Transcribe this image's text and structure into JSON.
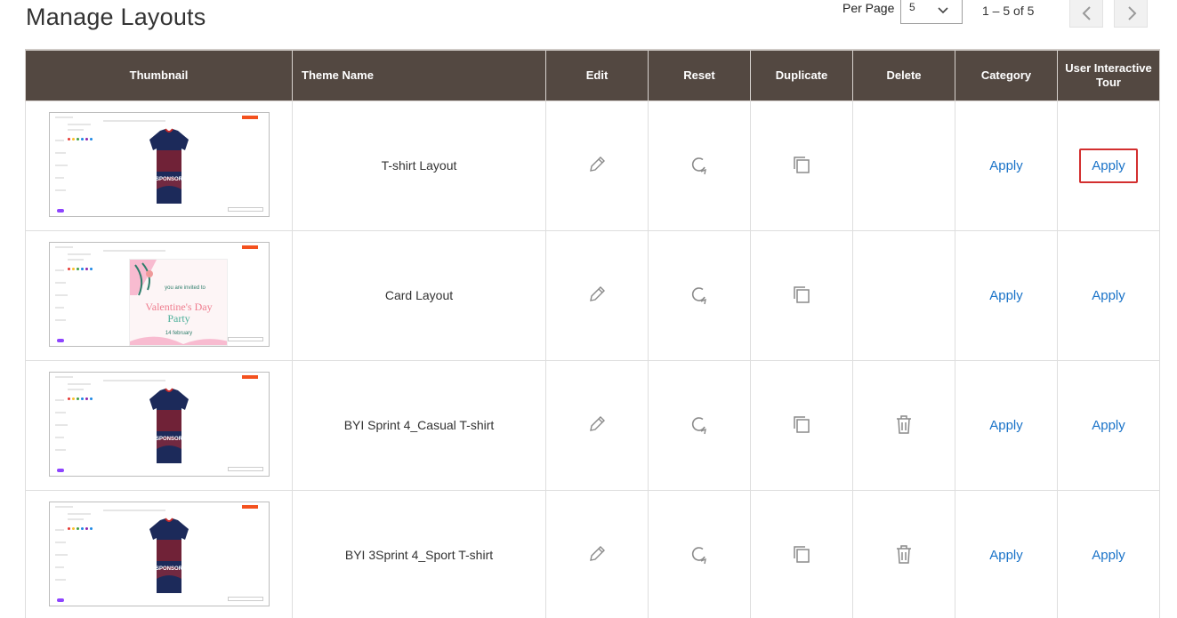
{
  "page": {
    "title": "Manage Layouts"
  },
  "pagination": {
    "per_page_label": "Per Page",
    "per_page_value": "5",
    "range_text": "1 – 5 of 5"
  },
  "table": {
    "headers": [
      "Thumbnail",
      "Theme Name",
      "Edit",
      "Reset",
      "Duplicate",
      "Delete",
      "Category",
      "User Interactive Tour"
    ],
    "rows": [
      {
        "thumbnail": "tshirt",
        "theme_name": "T-shirt Layout",
        "has_delete": false,
        "category_action": "Apply",
        "tour_action": "Apply",
        "tour_highlighted": true
      },
      {
        "thumbnail": "card",
        "theme_name": "Card Layout",
        "has_delete": false,
        "category_action": "Apply",
        "tour_action": "Apply",
        "tour_highlighted": false,
        "thumbnail_text": {
          "line1": "you are invited to",
          "line2": "Valentine's Day",
          "line3": "Party",
          "line4": "14 february"
        }
      },
      {
        "thumbnail": "tshirt",
        "theme_name": "BYI Sprint 4_Casual T-shirt",
        "has_delete": true,
        "category_action": "Apply",
        "tour_action": "Apply",
        "tour_highlighted": false
      },
      {
        "thumbnail": "tshirt",
        "theme_name": "BYI 3Sprint 4_Sport T-shirt",
        "has_delete": true,
        "category_action": "Apply",
        "tour_action": "Apply",
        "tour_highlighted": false
      }
    ]
  },
  "thumbnail_shirt_text": "SPONSOR",
  "icons": {
    "edit": "pencil-icon",
    "reset": "refresh-icon",
    "duplicate": "copy-icon",
    "delete": "trash-icon",
    "prev": "chevron-left-icon",
    "next": "chevron-right-icon",
    "select": "chevron-down-icon"
  },
  "colors": {
    "header_bg": "#534841",
    "link": "#1a73c8",
    "highlight_border": "#d32f2f",
    "shirt_navy": "#1c2a5a",
    "shirt_red": "#c62828"
  }
}
